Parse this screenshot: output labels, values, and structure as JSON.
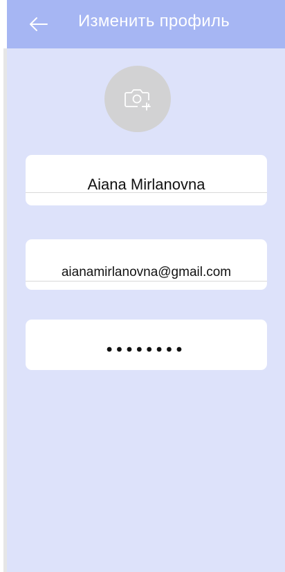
{
  "header": {
    "title": "Изменить профиль",
    "back_icon": "arrow-left-icon"
  },
  "avatar": {
    "icon": "camera-add-icon"
  },
  "form": {
    "name_value": "Aiana Mirlanovna",
    "email_value": "aianamirlanovna@gmail.com",
    "password_value": "••••••••"
  },
  "colors": {
    "header_bg": "#a6b6f3",
    "screen_bg": "#dde2fa",
    "avatar_bg": "#d2d2d3",
    "field_bg": "#ffffff"
  }
}
